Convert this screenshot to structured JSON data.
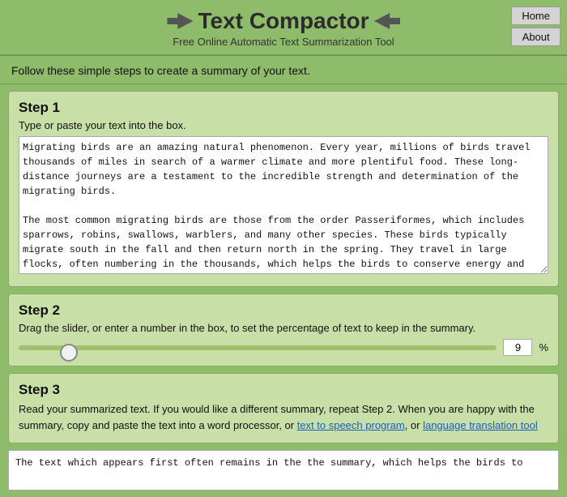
{
  "header": {
    "title": "Text Compactor",
    "subtitle": "Free Online Automatic Text Summarization Tool",
    "icon_left": "arrow-left-icon",
    "icon_right": "arrow-right-icon"
  },
  "nav": {
    "home_label": "Home",
    "about_label": "About"
  },
  "intro": {
    "text": "Follow these simple steps to create a summary of your text."
  },
  "step1": {
    "title": "Step 1",
    "instruction": "Type or paste your text into the box.",
    "textarea_value": "Migrating birds are an amazing natural phenomenon. Every year, millions of birds travel thousands of miles in search of a warmer climate and more plentiful food. These long-distance journeys are a testament to the incredible strength and determination of the migrating birds.\n\nThe most common migrating birds are those from the order Passeriformes, which includes sparrows, robins, swallows, warblers, and many other species. These birds typically migrate south in the fall and then return north in the spring. They travel in large flocks, often numbering in the thousands, which helps the birds to conserve energy and stay safe from predators.\n\nIn addition to the birds from the Passeriformes order, some other species of birds also migrate. Geese, ducks, and swans are among the most well-known migratory waterfowl. They fly in large V-shaped formations, which help them to utilize the air currents more efficiently. Other birds that migrate include raptors such as eagles and hawks, as well as seabirds and shorebirds.\n\nThe exact motivations behind bird migration still remain a mystery. In some cases, the birds are"
  },
  "step2": {
    "title": "Step 2",
    "instruction": "Drag the slider, or enter a number in the box, to set the percentage of text to keep in the summary.",
    "slider_min": 0,
    "slider_max": 100,
    "slider_value": 9,
    "percent_label": "%"
  },
  "step3": {
    "title": "Step 3",
    "instruction_part1": "Read your summarized text. If you would like a different summary, repeat Step 2. When you are happy with the summary, copy and paste the text into a word processor, or ",
    "link1_text": "text to speech program",
    "link1_href": "#",
    "instruction_part2": ", or ",
    "link2_text": "language translation tool",
    "link2_href": "#",
    "instruction_part3": ""
  },
  "output": {
    "text": "The text which appears first often remains in the the summary, which helps the birds to"
  }
}
